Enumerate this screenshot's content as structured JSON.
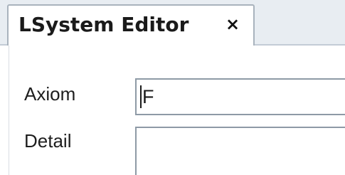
{
  "editor_tab": {
    "title": "LSystem Editor",
    "close_glyph": "×",
    "close_icon": "close-icon"
  },
  "form": {
    "axiom": {
      "label": "Axiom",
      "value": "F"
    },
    "detail": {
      "label": "Detail",
      "value": ""
    }
  }
}
